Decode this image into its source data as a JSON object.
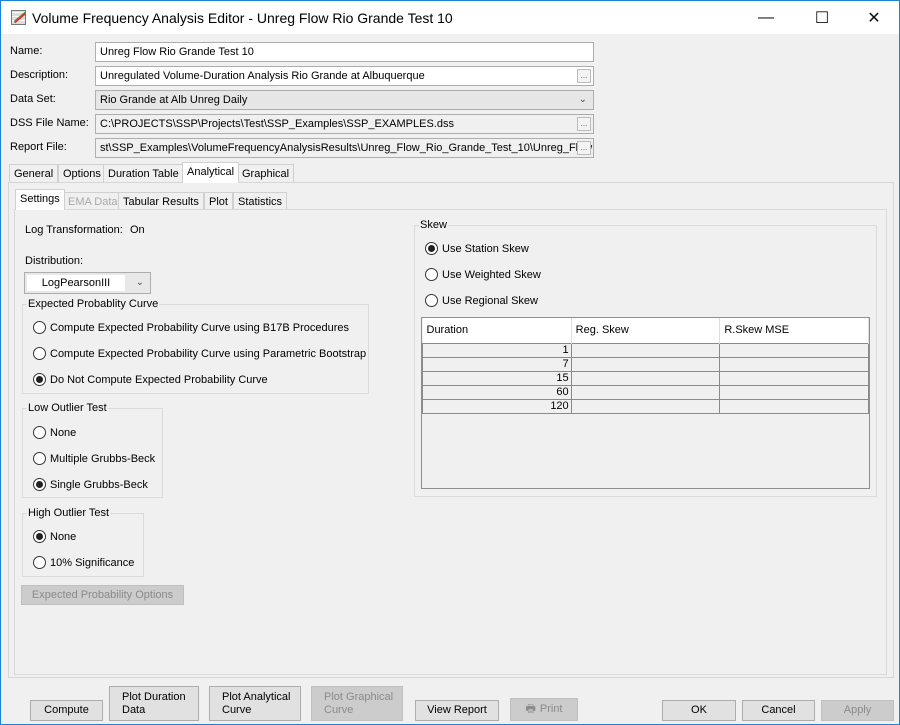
{
  "window": {
    "title": "Volume Frequency Analysis Editor - Unreg Flow Rio Grande Test 10",
    "icon": "chart-icon",
    "minimize_glyph": "—",
    "maximize_glyph": "☐",
    "close_glyph": "✕"
  },
  "form": {
    "name_label": "Name:",
    "name_value": "Unreg Flow Rio Grande Test 10",
    "description_label": "Description:",
    "description_value": "Unregulated Volume-Duration Analysis Rio Grande at Albuquerque",
    "dataset_label": "Data Set:",
    "dataset_value": "Rio Grande at Alb Unreg Daily",
    "dss_label": "DSS File Name:",
    "dss_value": "C:\\PROJECTS\\SSP\\Projects\\Test\\SSP_Examples\\SSP_EXAMPLES.dss",
    "report_label": "Report File:",
    "report_value": "st\\SSP_Examples\\VolumeFrequencyAnalysisResults\\Unreg_Flow_Rio_Grande_Test_10\\Unreg_Flow",
    "browse_glyph": "...",
    "dropdown_glyph": "⌄"
  },
  "main_tabs": [
    {
      "label": "General",
      "active": false
    },
    {
      "label": "Options",
      "active": false
    },
    {
      "label": "Duration Table",
      "active": false
    },
    {
      "label": "Analytical",
      "active": true
    },
    {
      "label": "Graphical",
      "active": false
    }
  ],
  "sub_tabs": [
    {
      "label": "Settings",
      "active": true,
      "enabled": true
    },
    {
      "label": "EMA Data",
      "active": false,
      "enabled": false
    },
    {
      "label": "Tabular Results",
      "active": false,
      "enabled": true
    },
    {
      "label": "Plot",
      "active": false,
      "enabled": true
    },
    {
      "label": "Statistics",
      "active": false,
      "enabled": true
    }
  ],
  "settings": {
    "log_transform_label": "Log Transformation:",
    "log_transform_value": "On",
    "distribution_label": "Distribution:",
    "distribution_value": "LogPearsonIII",
    "expected_prob": {
      "title": "Expected Probablity Curve",
      "options": [
        {
          "label": "Compute Expected Probability Curve using B17B Procedures",
          "selected": false
        },
        {
          "label": "Compute Expected Probability Curve using Parametric Bootstrap",
          "selected": false
        },
        {
          "label": "Do Not Compute Expected Probability Curve",
          "selected": true
        }
      ]
    },
    "low_outlier": {
      "title": "Low Outlier Test",
      "options": [
        {
          "label": "None",
          "selected": false
        },
        {
          "label": "Multiple Grubbs-Beck",
          "selected": false
        },
        {
          "label": "Single Grubbs-Beck",
          "selected": true
        }
      ]
    },
    "high_outlier": {
      "title": "High Outlier Test",
      "options": [
        {
          "label": "None",
          "selected": true
        },
        {
          "label": "10% Significance",
          "selected": false
        }
      ]
    },
    "expected_prob_options_button": "Expected Probability Options",
    "skew": {
      "title": "Skew",
      "options": [
        {
          "label": "Use Station Skew",
          "selected": true
        },
        {
          "label": "Use Weighted Skew",
          "selected": false
        },
        {
          "label": "Use Regional Skew",
          "selected": false
        }
      ],
      "table": {
        "columns": [
          "Duration",
          "Reg. Skew",
          "R.Skew MSE"
        ],
        "rows": [
          [
            "1",
            "",
            ""
          ],
          [
            "7",
            "",
            ""
          ],
          [
            "15",
            "",
            ""
          ],
          [
            "60",
            "",
            ""
          ],
          [
            "120",
            "",
            ""
          ]
        ]
      }
    }
  },
  "buttons": {
    "compute": "Compute",
    "plot_duration": "Plot Duration\nData",
    "plot_duration_1": "Plot Duration",
    "plot_duration_2": "Data",
    "plot_analytical_1": "Plot Analytical",
    "plot_analytical_2": "Curve",
    "plot_graphical_1": "Plot Graphical",
    "plot_graphical_2": "Curve",
    "view_report": "View Report",
    "print": "Print",
    "print_icon": "🖶",
    "ok": "OK",
    "cancel": "Cancel",
    "apply": "Apply"
  }
}
